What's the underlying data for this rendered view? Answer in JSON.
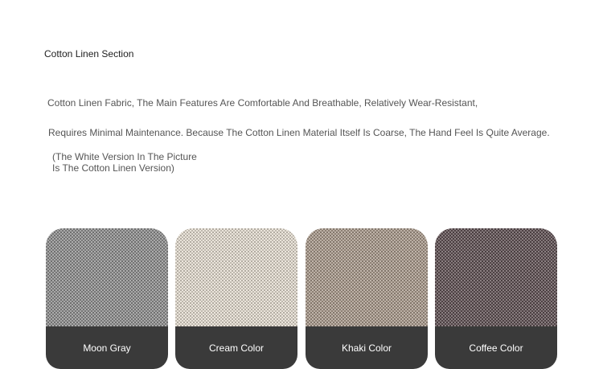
{
  "section": {
    "title": "Cotton Linen Section",
    "description_line_1": "Cotton Linen Fabric, The Main Features Are Comfortable And Breathable, Relatively Wear-Resistant,",
    "description_line_2": "Requires Minimal Maintenance. Because The Cotton Linen Material Itself Is Coarse, The Hand Feel Is Quite Average.",
    "note_line_1": "(The White Version In The Picture",
    "note_line_2": "Is The Cotton Linen Version)"
  },
  "swatches": [
    {
      "label": "Moon Gray",
      "color": "#8e8e8e"
    },
    {
      "label": "Cream Color",
      "color": "#e4ddd0"
    },
    {
      "label": "Khaki Color",
      "color": "#a8998a"
    },
    {
      "label": "Coffee Color",
      "color": "#5e4f52"
    }
  ]
}
